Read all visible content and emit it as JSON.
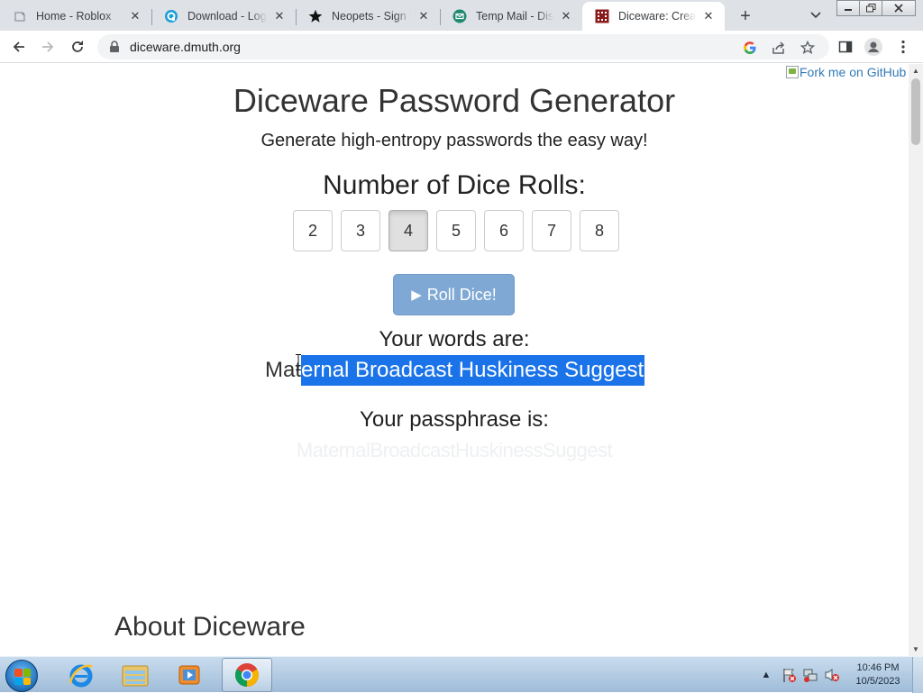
{
  "browser": {
    "tabs": [
      {
        "title": "Home - Roblox",
        "icon": "roblox-page-icon"
      },
      {
        "title": "Download - Logitech",
        "icon": "logitech-icon"
      },
      {
        "title": "Neopets - Sign Up",
        "icon": "neopets-star-icon"
      },
      {
        "title": "Temp Mail - Disposable",
        "icon": "tempmail-icon"
      },
      {
        "title": "Diceware: Create",
        "icon": "diceware-icon",
        "active": true
      }
    ],
    "url": "diceware.dmuth.org",
    "window_controls": [
      "minimize",
      "restore",
      "close"
    ]
  },
  "page": {
    "fork_link": "Fork me on GitHub",
    "title": "Diceware Password Generator",
    "subtitle": "Generate high-entropy passwords the easy way!",
    "dice_heading": "Number of Dice Rolls:",
    "dice_options": [
      "2",
      "3",
      "4",
      "5",
      "6",
      "7",
      "8"
    ],
    "selected_dice": "4",
    "roll_button": "Roll Dice!",
    "words_label": "Your words are:",
    "words_unselected": "Mat",
    "words_selected": "ernal Broadcast Huskiness Suggest",
    "passphrase_label": "Your passphrase is:",
    "passphrase": "MaternalBroadcastHuskinessSuggest",
    "about_heading": "About Diceware"
  },
  "taskbar": {
    "apps": [
      "internet-explorer",
      "windows-explorer",
      "media-player",
      "google-chrome"
    ],
    "active_app": "google-chrome",
    "clock_time": "10:46 PM",
    "clock_date": "10/5/2023"
  },
  "colors": {
    "selection": "#1a73e8",
    "roll_button": "#7fa9d4",
    "link": "#337ab7",
    "diceware_icon": "#8b1a1a"
  }
}
